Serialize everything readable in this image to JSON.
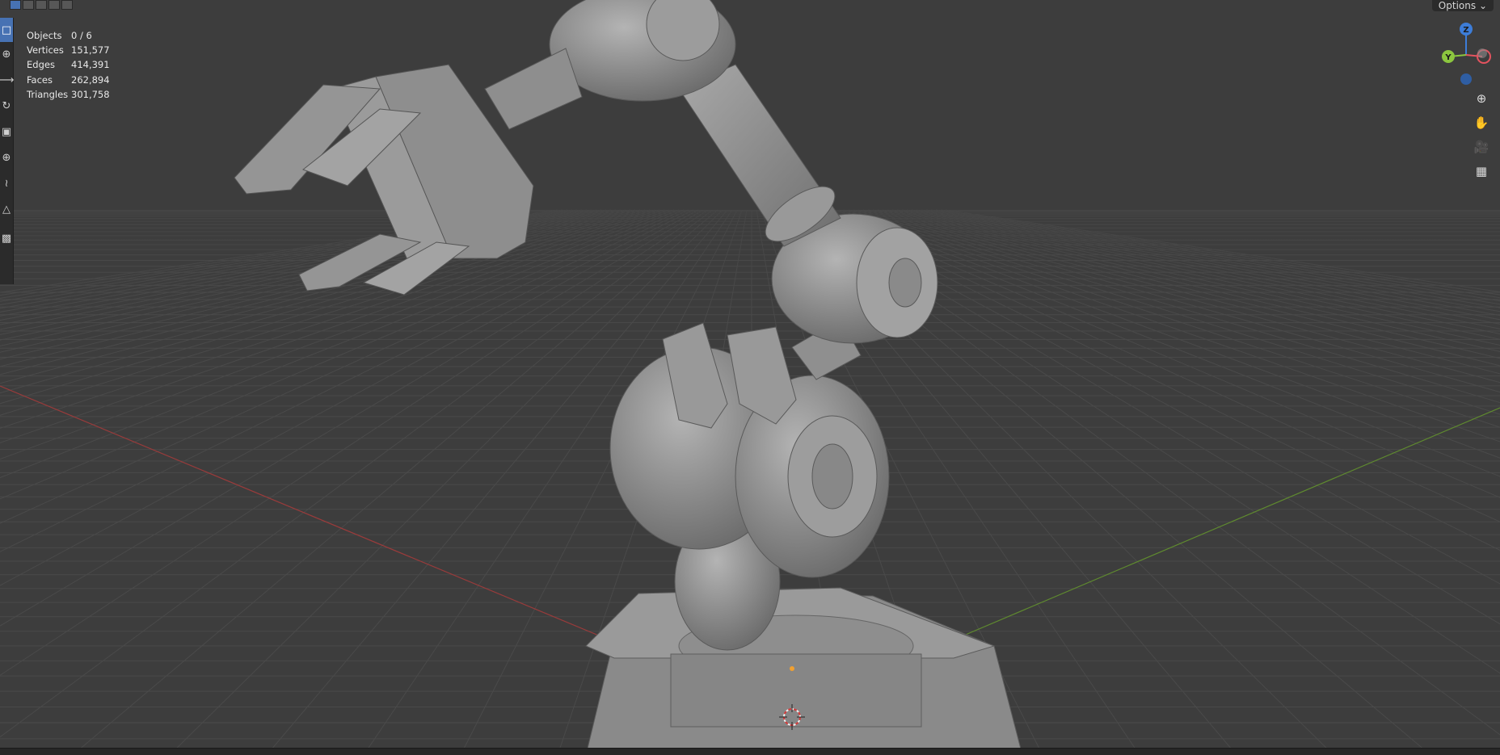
{
  "header": {
    "options_label": "Options"
  },
  "stats": [
    {
      "label": "Objects",
      "value": "0 / 6"
    },
    {
      "label": "Vertices",
      "value": "151,577"
    },
    {
      "label": "Edges",
      "value": "414,391"
    },
    {
      "label": "Faces",
      "value": "262,894"
    },
    {
      "label": "Triangles",
      "value": "301,758"
    }
  ],
  "gizmo": {
    "z_label": "Z",
    "y_label": "Y",
    "x_color": "#e4535f",
    "y_color": "#8cc63f",
    "z_color": "#3d7dd8"
  },
  "toolbar": {
    "tools": [
      "select-box-icon",
      "cursor-icon",
      "move-icon",
      "rotate-icon",
      "scale-icon",
      "transform-icon",
      "annotate-icon",
      "measure-icon",
      "add-cube-icon"
    ]
  },
  "nav": [
    "zoom-icon",
    "hand-icon",
    "camera-icon",
    "grid-view-icon"
  ],
  "colors": {
    "background": "#3d3d3d",
    "grid_line": "#494949",
    "x_axis": "#9a3b3b",
    "y_axis": "#5f8a2f",
    "accent": "#4772b3",
    "model": "#8f8f8f"
  }
}
